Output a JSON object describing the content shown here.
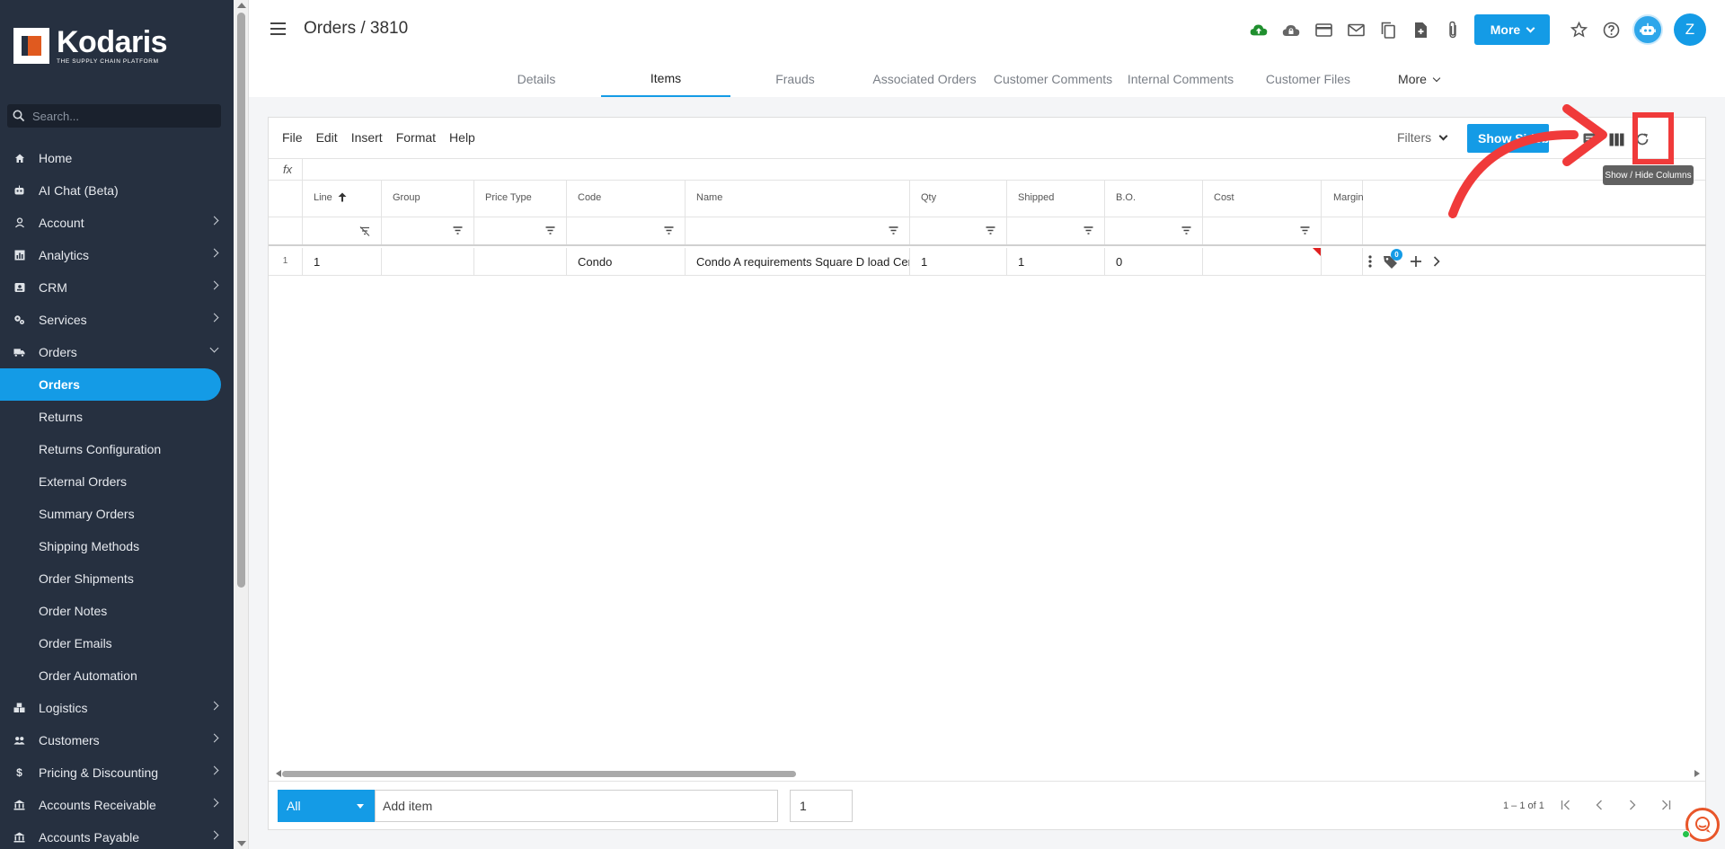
{
  "app": {
    "brand_name": "Kodaris",
    "brand_tagline": "THE SUPPLY CHAIN PLATFORM",
    "colors": {
      "accent": "#149be6",
      "sidebar": "#263040",
      "annotation": "#f03a3a",
      "brand": "#e05a1f"
    }
  },
  "sidebar": {
    "search_placeholder": "Search...",
    "items": [
      {
        "label": "Home",
        "icon": "home-icon"
      },
      {
        "label": "AI Chat (Beta)",
        "icon": "robot-icon"
      },
      {
        "label": "Account",
        "icon": "user-icon",
        "expandable": true
      },
      {
        "label": "Analytics",
        "icon": "chart-icon",
        "expandable": true
      },
      {
        "label": "CRM",
        "icon": "contact-card-icon",
        "expandable": true
      },
      {
        "label": "Services",
        "icon": "gears-icon",
        "expandable": true
      },
      {
        "label": "Orders",
        "icon": "truck-icon",
        "expandable": true,
        "expanded": true
      }
    ],
    "orders_sub": [
      {
        "label": "Orders",
        "active": true
      },
      {
        "label": "Returns"
      },
      {
        "label": "Returns Configuration"
      },
      {
        "label": "External Orders"
      },
      {
        "label": "Summary Orders"
      },
      {
        "label": "Shipping Methods"
      },
      {
        "label": "Order Shipments"
      },
      {
        "label": "Order Notes"
      },
      {
        "label": "Order Emails"
      },
      {
        "label": "Order Automation"
      }
    ],
    "items_after": [
      {
        "label": "Logistics",
        "icon": "boxes-icon",
        "expandable": true
      },
      {
        "label": "Customers",
        "icon": "users-icon",
        "expandable": true
      },
      {
        "label": "Pricing & Discounting",
        "icon": "dollar-icon",
        "expandable": true
      },
      {
        "label": "Accounts Receivable",
        "icon": "bank-icon",
        "expandable": true
      },
      {
        "label": "Accounts Payable",
        "icon": "bank-icon",
        "expandable": true
      }
    ]
  },
  "header": {
    "title": "Orders / 3810",
    "more_label": "More",
    "avatar_initial": "Z"
  },
  "tabs": [
    {
      "label": "Details"
    },
    {
      "label": "Items",
      "active": true
    },
    {
      "label": "Frauds"
    },
    {
      "label": "Associated Orders"
    },
    {
      "label": "Customer Comments"
    },
    {
      "label": "Internal Comments"
    },
    {
      "label": "Customer Files"
    },
    {
      "label": "More",
      "dropdown": true
    }
  ],
  "grid": {
    "menu": [
      "File",
      "Edit",
      "Insert",
      "Format",
      "Help"
    ],
    "filters_label": "Filters",
    "show_sidebar_label": "Show Sidebar",
    "fx_label": "fx",
    "columns": [
      "Line",
      "Group",
      "Price Type",
      "Code",
      "Name",
      "Qty",
      "Shipped",
      "B.O.",
      "Cost",
      "Margin"
    ],
    "sorted_column": "Line",
    "rows": [
      {
        "rownum": "1",
        "cells": [
          "1",
          "",
          "",
          "Condo",
          "Condo A requirements Square D load Center",
          "1",
          "1",
          "0",
          "",
          ""
        ]
      }
    ],
    "tag_badge_count": "0",
    "tooltip": "Show / Hide Columns"
  },
  "footer": {
    "scope_value": "All",
    "add_item_placeholder": "Add item",
    "quantity_value": "1",
    "pagination_text": "1 – 1 of 1"
  }
}
